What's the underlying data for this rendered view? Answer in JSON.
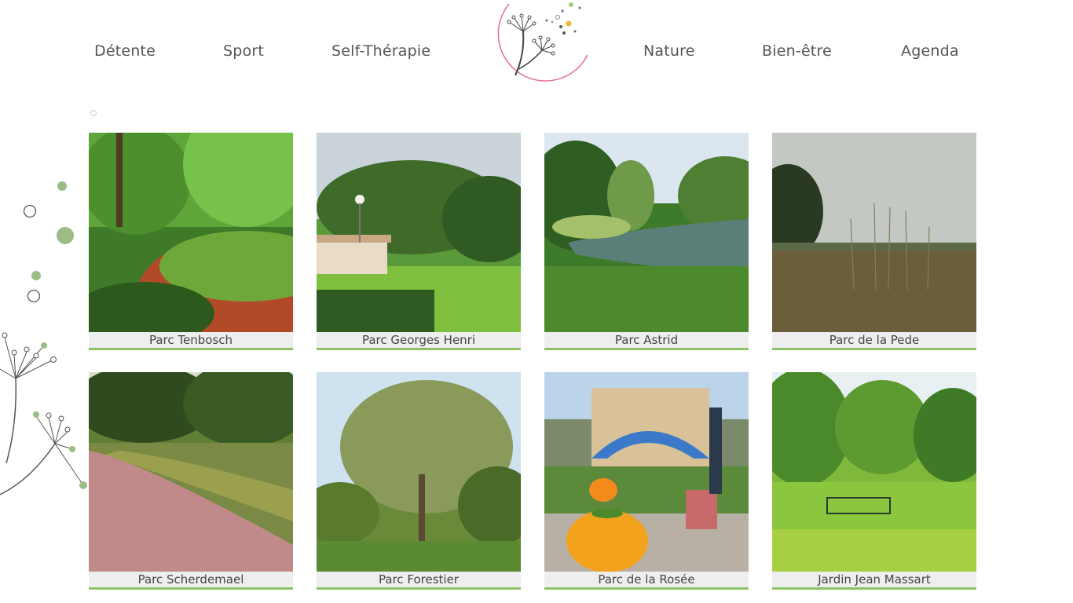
{
  "nav": {
    "left": [
      "Détente",
      "Sport",
      "Self-Thérapie"
    ],
    "right": [
      "Nature",
      "Bien-être",
      "Agenda"
    ]
  },
  "colors": {
    "accent_green": "#8cc265",
    "logo_ring": "#e0708a",
    "text": "#555555"
  },
  "logo": {
    "icon": "dandelion-logo-icon"
  },
  "parks": [
    {
      "name": "Parc Tenbosch"
    },
    {
      "name": "Parc Georges Henri"
    },
    {
      "name": "Parc Astrid"
    },
    {
      "name": "Parc de la Pede"
    },
    {
      "name": "Parc Scherdemael"
    },
    {
      "name": "Parc Forestier"
    },
    {
      "name": "Parc de la Rosée"
    },
    {
      "name": "Jardin Jean Massart"
    }
  ]
}
